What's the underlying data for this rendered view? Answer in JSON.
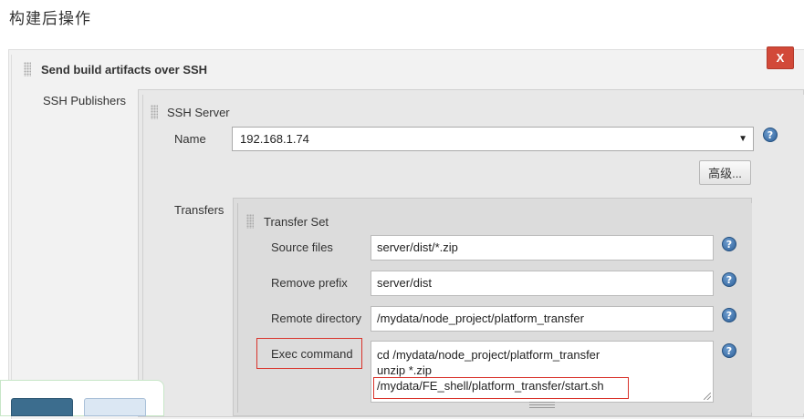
{
  "section": {
    "title": "构建后操作"
  },
  "step": {
    "title": "Send build artifacts over SSH",
    "delete_label": "X",
    "publishers_label": "SSH Publishers"
  },
  "ssh_server": {
    "title": "SSH Server",
    "name_label": "Name",
    "name_value": "192.168.1.74",
    "help": "?",
    "advanced_label": "高级...",
    "transfers_label": "Transfers"
  },
  "transfer_set": {
    "title": "Transfer Set",
    "source_files_label": "Source files",
    "source_files_value": "server/dist/*.zip",
    "remove_prefix_label": "Remove prefix",
    "remove_prefix_value": "server/dist",
    "remote_dir_label": "Remote directory",
    "remote_dir_value": "/mydata/node_project/platform_transfer",
    "exec_command_label": "Exec command",
    "exec_lines": [
      "cd /mydata/node_project/platform_transfer",
      "unzip *.zip",
      "/mydata/FE_shell/platform_transfer/start.sh"
    ]
  },
  "colors": {
    "delete": "#d24939",
    "help": "#2c5f98",
    "highlight": "#d9332b",
    "save_button": "#3c6d8e",
    "apply_button": "#dbe7f3"
  }
}
